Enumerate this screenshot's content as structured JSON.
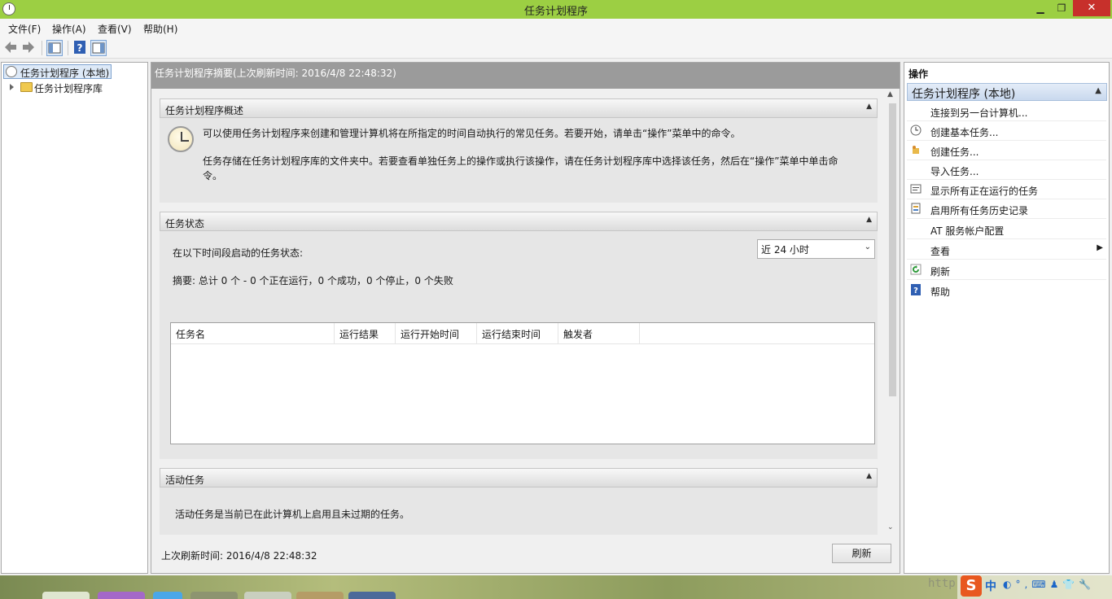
{
  "window": {
    "title": "任务计划程序"
  },
  "menu": {
    "items": [
      "文件(F)",
      "操作(A)",
      "查看(V)",
      "帮助(H)"
    ]
  },
  "tree": {
    "root_label": "任务计划程序 (本地)",
    "child_label": "任务计划程序库"
  },
  "center": {
    "header": "任务计划程序摘要(上次刷新时间: 2016/4/8 22:48:32)",
    "overview": {
      "title": "任务计划程序概述",
      "para1": "可以使用任务计划程序来创建和管理计算机将在所指定的时间自动执行的常见任务。若要开始，请单击“操作”菜单中的命令。",
      "para2": "任务存储在任务计划程序库的文件夹中。若要查看单独任务上的操作或执行该操作，请在任务计划程序库中选择该任务，然后在“操作”菜单中单击命令。"
    },
    "status": {
      "title": "任务状态",
      "period_label": "在以下时间段启动的任务状态:",
      "period_value": "近 24 小时",
      "summary": "摘要: 总计 0 个 - 0 个正在运行，0 个成功，0 个停止，0 个失败",
      "columns": [
        "任务名",
        "运行结果",
        "运行开始时间",
        "运行结束时间",
        "触发者"
      ]
    },
    "active": {
      "title": "活动任务",
      "text": "活动任务是当前已在此计算机上启用且未过期的任务。"
    },
    "footer": {
      "last_refresh": "上次刷新时间: 2016/4/8 22:48:32",
      "refresh_button": "刷新"
    }
  },
  "actions": {
    "title": "操作",
    "group": "任务计划程序 (本地)",
    "items": [
      {
        "label": "连接到另一台计算机...",
        "icon": "none"
      },
      {
        "label": "创建基本任务...",
        "icon": "basic-task-icon"
      },
      {
        "label": "创建任务...",
        "icon": "create-task-icon"
      },
      {
        "label": "导入任务...",
        "icon": "none"
      },
      {
        "label": "显示所有正在运行的任务",
        "icon": "running-tasks-icon"
      },
      {
        "label": "启用所有任务历史记录",
        "icon": "history-icon"
      },
      {
        "label": "AT 服务帐户配置",
        "icon": "none"
      },
      {
        "label": "查看",
        "icon": "none"
      },
      {
        "label": "刷新",
        "icon": "refresh-icon"
      },
      {
        "label": "帮助",
        "icon": "help-icon"
      }
    ]
  },
  "taskbar": {
    "ime": "中",
    "watermark": "http"
  },
  "colors": {
    "titlebar": "#9ccf43",
    "close_button": "#c7302b",
    "selection": "#dde9f7"
  }
}
